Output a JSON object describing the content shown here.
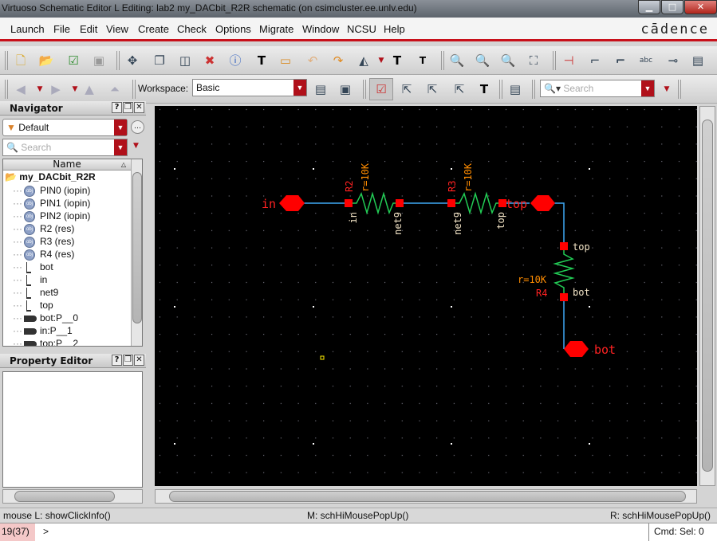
{
  "window": {
    "title": "Virtuoso Schematic Editor L Editing: lab2 my_DACbit_R2R schematic (on csimcluster.ee.unlv.edu)",
    "controls": [
      "minimize",
      "maximize",
      "close"
    ]
  },
  "menu": {
    "items": [
      "Launch",
      "File",
      "Edit",
      "View",
      "Create",
      "Check",
      "Options",
      "Migrate",
      "Window",
      "NCSU",
      "Help"
    ],
    "brand": "cādence"
  },
  "toolbar1": {
    "icons": [
      "new-icon",
      "open-icon",
      "check-save-icon",
      "save-icon",
      "move-icon",
      "copy-icon",
      "stretch-icon",
      "delete-icon",
      "properties-icon",
      "text-icon",
      "label-icon",
      "undo-icon",
      "redo-icon",
      "rotate-icon",
      "text-up-icon",
      "text-down-icon",
      "zoom-in-icon",
      "zoom-out-icon",
      "zoom-fit-icon",
      "zoom-select-icon",
      "instance-icon",
      "wire-icon",
      "wide-wire-icon",
      "wire-name-icon",
      "pin-icon",
      "sheet-icon"
    ]
  },
  "toolbar2": {
    "workspace_label": "Workspace:",
    "workspace_value": "Basic",
    "search_placeholder": "Search"
  },
  "navigator": {
    "title": "Navigator",
    "filter": "Default",
    "search_placeholder": "Search",
    "column": "Name",
    "root": "my_DACbit_R2R",
    "items": [
      {
        "type": "obj",
        "label": "PIN0 (iopin)"
      },
      {
        "type": "obj",
        "label": "PIN1 (iopin)"
      },
      {
        "type": "obj",
        "label": "PIN2 (iopin)"
      },
      {
        "type": "obj",
        "label": "R2 (res)"
      },
      {
        "type": "obj",
        "label": "R3 (res)"
      },
      {
        "type": "obj",
        "label": "R4 (res)"
      },
      {
        "type": "net",
        "label": "bot"
      },
      {
        "type": "net",
        "label": "in"
      },
      {
        "type": "net",
        "label": "net9"
      },
      {
        "type": "net",
        "label": "top"
      },
      {
        "type": "term",
        "label": "bot:P__0"
      },
      {
        "type": "term",
        "label": "in:P__1"
      },
      {
        "type": "term",
        "label": "top:P__2"
      }
    ]
  },
  "property_editor": {
    "title": "Property Editor"
  },
  "schematic": {
    "pins": {
      "in": "in",
      "top": "top",
      "bot": "bot"
    },
    "R2": {
      "name": "R2",
      "value": "r=10K",
      "t1": "in",
      "t2": "net9"
    },
    "R3": {
      "name": "R3",
      "value": "r=10K",
      "t1": "net9",
      "t2": "top"
    },
    "R4": {
      "name": "R4",
      "value": "r=10K",
      "t1": "top",
      "t2": "bot"
    },
    "colors": {
      "wire": "#3fa9f5",
      "resistor": "#22cc55",
      "pin": "#ff0000",
      "value": "#ff8c00",
      "label": "#ff2222",
      "terminal": "#f5e6c8"
    }
  },
  "status": {
    "left": "mouse L: showClickInfo()",
    "mid": "M: schHiMousePopUp()",
    "right": "R: schHiMousePopUp()"
  },
  "cmdline": {
    "counter": "19(37)",
    "prompt": ">",
    "sel": "Cmd: Sel: 0"
  }
}
